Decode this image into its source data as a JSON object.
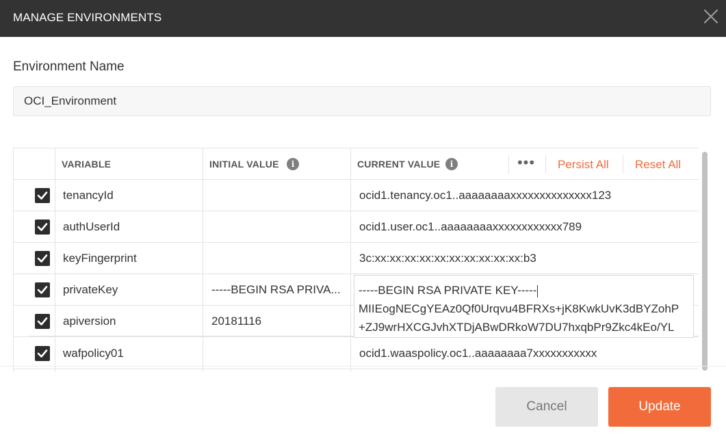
{
  "dialog": {
    "title": "MANAGE ENVIRONMENTS",
    "close_icon": "close-icon"
  },
  "environment": {
    "label": "Environment Name",
    "value": "OCI_Environment"
  },
  "table": {
    "headers": {
      "variable": "VARIABLE",
      "initial_value": "INITIAL VALUE",
      "current_value": "CURRENT VALUE"
    },
    "more_icon": "•••",
    "persist_all": "Persist All",
    "reset_all": "Reset All",
    "rows": [
      {
        "checked": true,
        "variable": "tenancyId",
        "initial": "",
        "current": "ocid1.tenancy.oc1..aaaaaaaaxxxxxxxxxxxxxx123"
      },
      {
        "checked": true,
        "variable": "authUserId",
        "initial": "",
        "current": "ocid1.user.oc1..aaaaaaaaxxxxxxxxxxxx789"
      },
      {
        "checked": true,
        "variable": "keyFingerprint",
        "initial": "",
        "current": "3c:xx:xx:xx:xx:xx:xx:xx:xx:xx:xx:b3"
      },
      {
        "checked": true,
        "variable": "privateKey",
        "initial": "-----BEGIN RSA PRIVA...",
        "current": ""
      },
      {
        "checked": true,
        "variable": "apiversion",
        "initial": "20181116",
        "current": ""
      },
      {
        "checked": true,
        "variable": "wafpolicy01",
        "initial": "",
        "current": "ocid1.waaspolicy.oc1..aaaaaaaa7xxxxxxxxxxx"
      }
    ],
    "editor_lines": [
      "-----BEGIN RSA PRIVATE KEY-----",
      "MIIEogNECgYEAz0Qf0Urqvu4BFRXs+jK8KwkUvK3dBYZohP",
      "+ZJ9wrHXCGJvhXTDjABwDRkoW7DU7hxqbPr9Zkc4kEo/YL"
    ]
  },
  "buttons": {
    "cancel": "Cancel",
    "update": "Update"
  },
  "colors": {
    "accent": "#f26b3a",
    "titlebar": "#333333"
  }
}
